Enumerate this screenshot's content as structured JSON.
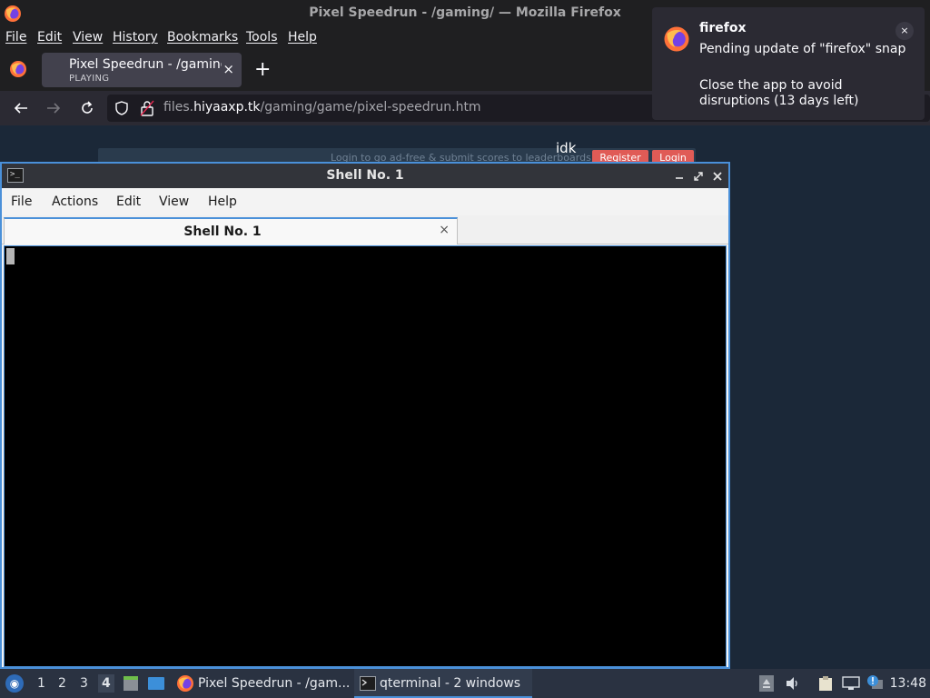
{
  "firefox": {
    "window_title": "Pixel Speedrun - /gaming/ — Mozilla Firefox",
    "menu": [
      "File",
      "Edit",
      "View",
      "History",
      "Bookmarks",
      "Tools",
      "Help"
    ],
    "tab": {
      "title": "Pixel Speedrun - /gaming",
      "subtitle": "PLAYING",
      "close": "×"
    },
    "new_tab": "+",
    "url": {
      "prefix": "files.",
      "domain": "hiyaaxp.tk",
      "path": "/gaming/game/pixel-speedrun.htm"
    }
  },
  "page": {
    "leaderboard_text": "Login to go ad-free & submit scores to leaderboards!",
    "register_label": "Register",
    "login_label": "Login",
    "idk": "idk"
  },
  "notification": {
    "app": "firefox",
    "line1": "Pending update of \"firefox\" snap",
    "line2": "Close the app to avoid disruptions (13 days left)",
    "close": "×"
  },
  "terminal": {
    "title": "Shell No. 1",
    "menu": [
      "File",
      "Actions",
      "Edit",
      "View",
      "Help"
    ],
    "tab_title": "Shell No. 1",
    "tab_close": "×"
  },
  "taskbar": {
    "workspaces": [
      "1",
      "2",
      "3",
      "4"
    ],
    "active_workspace": "4",
    "tasks": [
      "Pixel Speedrun - /gam...",
      "qterminal - 2 windows"
    ],
    "clock": "13:48"
  },
  "colors": {
    "accent": "#4a90d9",
    "button_red": "#e05b56",
    "page_bg": "#1b2838"
  }
}
